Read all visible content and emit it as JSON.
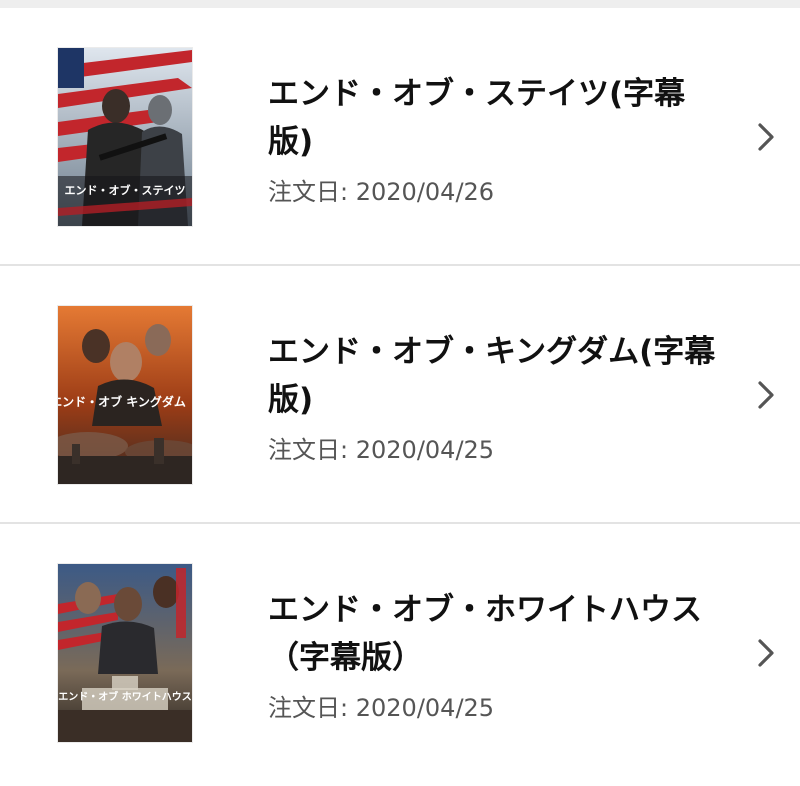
{
  "orders": [
    {
      "title": "エンド・オブ・ステイツ(字幕版)",
      "date_label": "注文日:",
      "date": "2020/04/26",
      "poster_caption": "エンド・オブ・ステイツ",
      "poster_icon": "movie-poster-icon",
      "accent_color": "#b21e24"
    },
    {
      "title": "エンド・オブ・キングダム(字幕版)",
      "date_label": "注文日:",
      "date": "2020/04/25",
      "poster_caption": "エンド・オブ キングダム",
      "poster_icon": "movie-poster-icon",
      "accent_color": "#d8642a"
    },
    {
      "title": "エンド・オブ・ホワイトハウス（字幕版）",
      "date_label": "注文日:",
      "date": "2020/04/25",
      "poster_caption": "エンド・オブ ホワイトハウス",
      "poster_icon": "movie-poster-icon",
      "accent_color": "#2a4a78"
    }
  ],
  "chevron_icon": "chevron-right-icon",
  "colors": {
    "divider": "#e3e3e3",
    "title": "#111111",
    "date": "#555555",
    "chevron": "#555555"
  }
}
